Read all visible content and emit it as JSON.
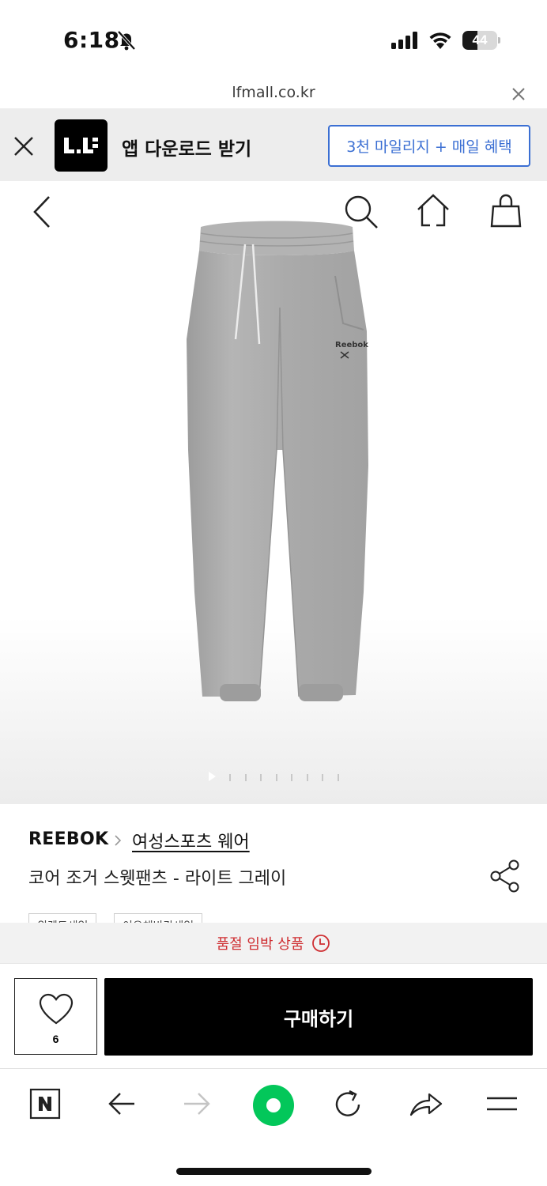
{
  "status_bar": {
    "time": "6:18",
    "battery_level": "44",
    "battery_fraction": 0.44
  },
  "url_bar": {
    "url": "lfmall.co.kr"
  },
  "app_banner": {
    "title": "앱 다운로드 받기",
    "cta_label": "3천 마일리지 + 매일 혜택"
  },
  "gallery": {
    "image_alt": "Reebok light grey jogger sweatpants",
    "page_count": 9,
    "current_page": 1
  },
  "product": {
    "brand": "REEBOK",
    "category": "여성스포츠 웨어",
    "name": "코어 조거 스웻팬츠 - 라이트 그레이",
    "tags": [
      "위켄드세일",
      "이유체반값세일"
    ]
  },
  "soldout_notice": "품절 임박 상품",
  "purchase_bar": {
    "like_count": "6",
    "buy_label": "구매하기"
  },
  "colors": {
    "accent_blue": "#3b6fd3",
    "soldout_red": "#cf2e32",
    "naver_green": "#03c75a",
    "buy_button": "#000000"
  }
}
